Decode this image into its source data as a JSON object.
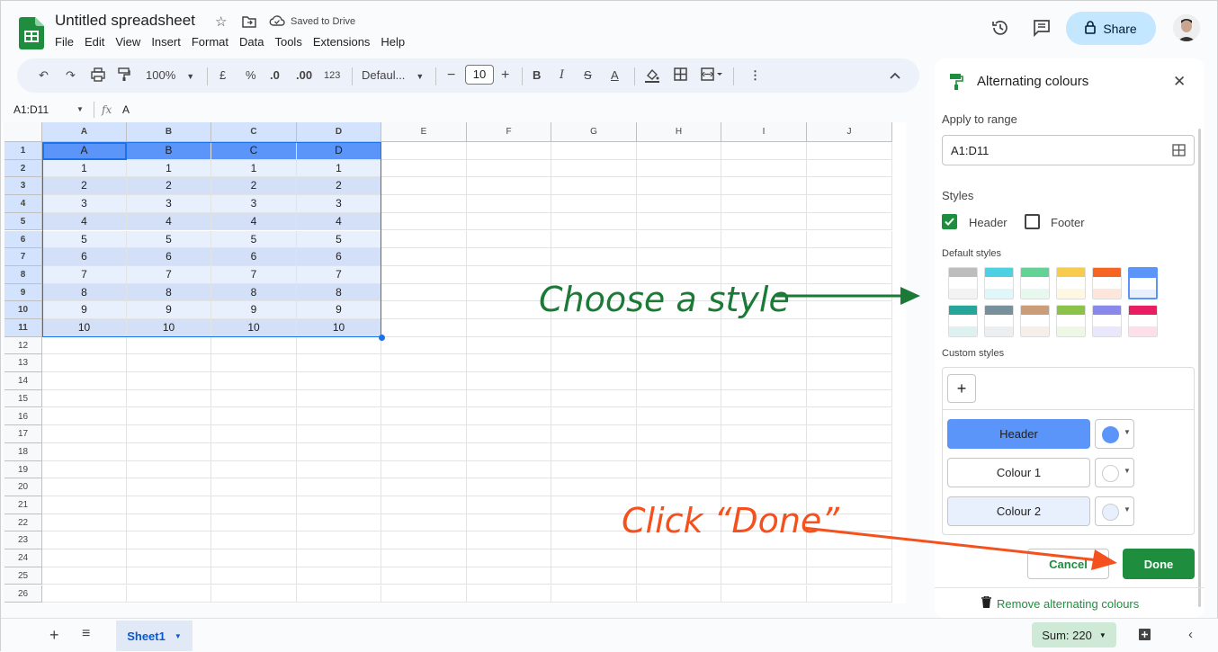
{
  "app": {
    "title": "Untitled spreadsheet",
    "saved_status": "Saved to Drive",
    "menu": [
      "File",
      "Edit",
      "View",
      "Insert",
      "Format",
      "Data",
      "Tools",
      "Extensions",
      "Help"
    ],
    "share_label": "Share",
    "brand_color": "#1e8e3e"
  },
  "toolbar": {
    "zoom": "100%",
    "currency": "£",
    "percent": "%",
    "dec_decrease": ".0",
    "dec_increase": ".00",
    "number_format": "123",
    "font": "Defaul...",
    "font_size": "10",
    "bold": "B",
    "italic": "I",
    "underline_color": "A"
  },
  "formula_bar": {
    "name_box": "A1:D11",
    "fx": "fx",
    "value": "A"
  },
  "sheet": {
    "columns": [
      "A",
      "B",
      "C",
      "D",
      "E",
      "F",
      "G",
      "H",
      "I",
      "J"
    ],
    "rows": [
      "1",
      "2",
      "3",
      "4",
      "5",
      "6",
      "7",
      "8",
      "9",
      "10",
      "11",
      "12",
      "13",
      "14",
      "15",
      "16",
      "17",
      "18",
      "19",
      "20",
      "21",
      "22",
      "23",
      "24",
      "25",
      "26"
    ],
    "data": [
      [
        "A",
        "B",
        "C",
        "D"
      ],
      [
        "1",
        "1",
        "1",
        "1"
      ],
      [
        "2",
        "2",
        "2",
        "2"
      ],
      [
        "3",
        "3",
        "3",
        "3"
      ],
      [
        "4",
        "4",
        "4",
        "4"
      ],
      [
        "5",
        "5",
        "5",
        "5"
      ],
      [
        "6",
        "6",
        "6",
        "6"
      ],
      [
        "7",
        "7",
        "7",
        "7"
      ],
      [
        "8",
        "8",
        "8",
        "8"
      ],
      [
        "9",
        "9",
        "9",
        "9"
      ],
      [
        "10",
        "10",
        "10",
        "10"
      ]
    ],
    "header_color": "#5b95f9",
    "alt_color": "#e8f0fe"
  },
  "panel": {
    "title": "Alternating colours",
    "apply_label": "Apply to range",
    "range_value": "A1:D11",
    "styles_label": "Styles",
    "header_checkbox": "Header",
    "header_checked": true,
    "footer_checkbox": "Footer",
    "footer_checked": false,
    "default_styles_label": "Default styles",
    "default_styles": [
      {
        "top": "#bdbdbd",
        "alt": "#f3f3f3"
      },
      {
        "top": "#4dd0e1",
        "alt": "#e0f7fa"
      },
      {
        "top": "#63d297",
        "alt": "#e7f9ef"
      },
      {
        "top": "#f7cb4d",
        "alt": "#fef8e3"
      },
      {
        "top": "#f46524",
        "alt": "#ffe6dd"
      },
      {
        "top": "#5b95f9",
        "alt": "#e8f0fe"
      },
      {
        "top": "#26a69a",
        "alt": "#ddf2f0"
      },
      {
        "top": "#78909c",
        "alt": "#ebeff1"
      },
      {
        "top": "#ca9c78",
        "alt": "#f6efe9"
      },
      {
        "top": "#8bc34a",
        "alt": "#eef7e3"
      },
      {
        "top": "#8989eb",
        "alt": "#e8e7fc"
      },
      {
        "top": "#e91d63",
        "alt": "#fddee9"
      }
    ],
    "custom_styles_label": "Custom styles",
    "add_label": "+",
    "header_label": "Header",
    "colour1_label": "Colour 1",
    "colour2_label": "Colour 2",
    "cancel_label": "Cancel",
    "done_label": "Done",
    "remove_label": "Remove alternating colours"
  },
  "annotations": {
    "style_note": "Choose a style",
    "done_note": "Click “Done”"
  },
  "bottom": {
    "sheet_tab": "Sheet1",
    "sum_label": "Sum: 220"
  }
}
